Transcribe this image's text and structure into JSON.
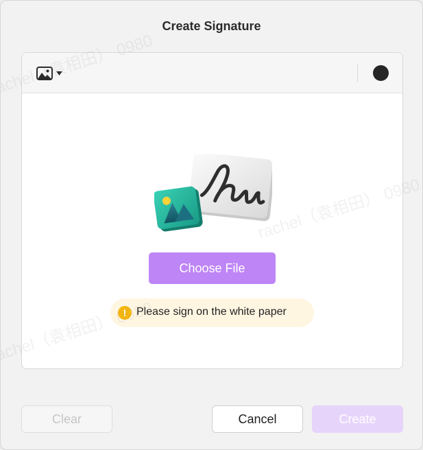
{
  "dialog": {
    "title": "Create Signature"
  },
  "toolbar": {
    "mode_icon": "image-icon",
    "mode_menu_icon": "caret-down-icon",
    "pen_color": "#262626"
  },
  "content": {
    "choose_file_label": "Choose File",
    "hint_text": "Please sign on the white paper",
    "hint_icon": "warning-icon"
  },
  "footer": {
    "clear_label": "Clear",
    "cancel_label": "Cancel",
    "create_label": "Create"
  },
  "watermark": {
    "text": "rachel（袁相田） 0980"
  },
  "colors": {
    "accent": "#be85f6",
    "accent_disabled": "#e6d4fb",
    "hint_background": "#fff6e2",
    "warning": "#f5b60e"
  }
}
